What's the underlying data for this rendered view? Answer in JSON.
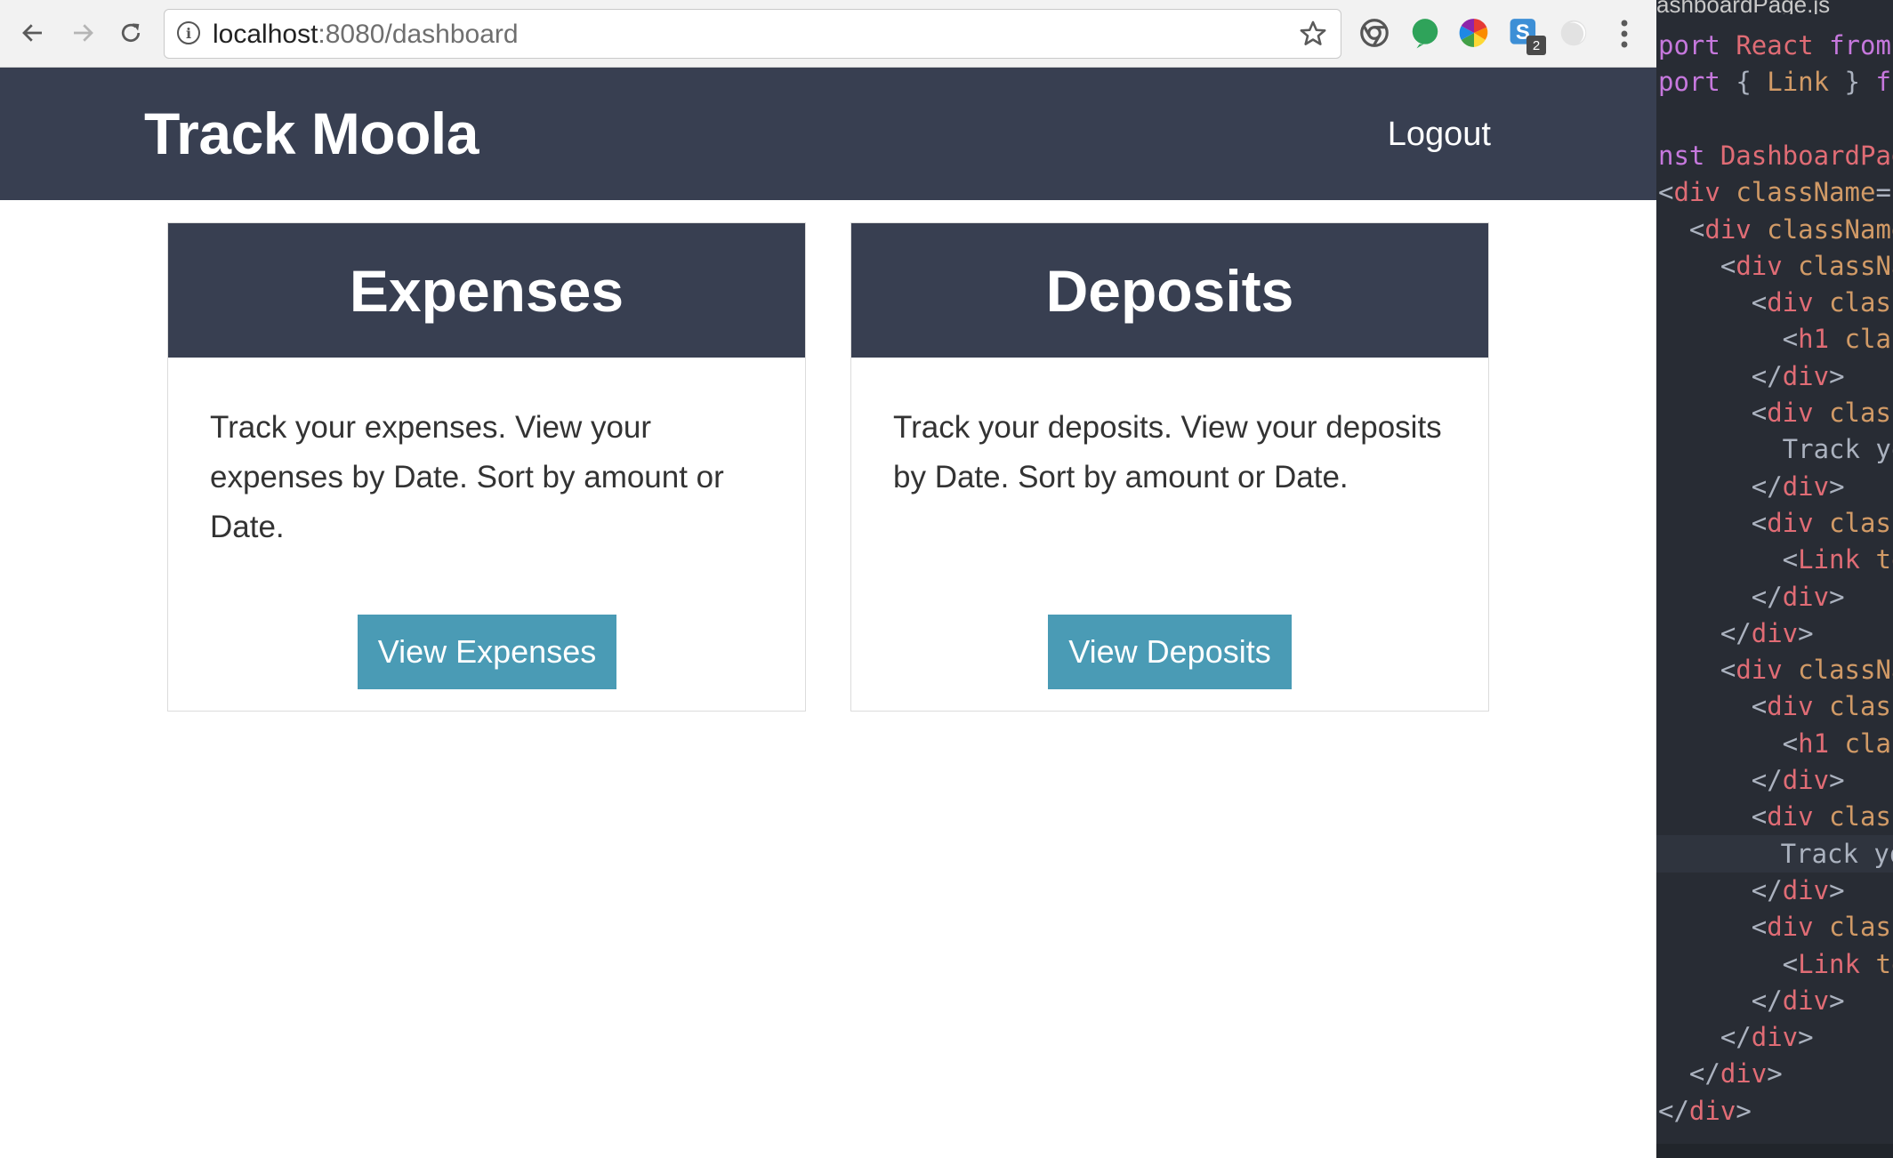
{
  "browser": {
    "url_host": "localhost",
    "url_rest": ":8080/dashboard",
    "extensions": [
      {
        "icon": "chrome-circle-icon"
      },
      {
        "icon": "green-leaf-icon"
      },
      {
        "icon": "color-wheel-icon"
      },
      {
        "icon": "s-extension-icon",
        "badge": "2"
      },
      {
        "icon": "faded-extension-icon"
      }
    ]
  },
  "app": {
    "brand": "Track Moola",
    "logout_label": "Logout",
    "header_color": "#383f51",
    "button_color": "#4a9bb5"
  },
  "cards": [
    {
      "title": "Expenses",
      "description": "Track your expenses. View your expenses by Date. Sort by amount or Date.",
      "button_label": "View Expenses"
    },
    {
      "title": "Deposits",
      "description": "Track your deposits. View your deposits by Date. Sort by amount or Date.",
      "button_label": "View Deposits"
    }
  ],
  "editor": {
    "tab_title": "ashboardPage.js",
    "lines": [
      {
        "tokens": [
          {
            "t": "port ",
            "c": "kw"
          },
          {
            "t": "React ",
            "c": "tag"
          },
          {
            "t": "from",
            "c": "kw"
          }
        ]
      },
      {
        "tokens": [
          {
            "t": "port ",
            "c": "kw"
          },
          {
            "t": "{ ",
            "c": "plain"
          },
          {
            "t": "Link",
            "c": "attr"
          },
          {
            "t": " } ",
            "c": "plain"
          },
          {
            "t": "fr",
            "c": "kw"
          }
        ]
      },
      {
        "tokens": []
      },
      {
        "tokens": [
          {
            "t": "nst ",
            "c": "kw"
          },
          {
            "t": "DashboardPag",
            "c": "tag"
          }
        ]
      },
      {
        "tokens": [
          {
            "t": "<",
            "c": "plain"
          },
          {
            "t": "div ",
            "c": "tag"
          },
          {
            "t": "className",
            "c": "attr"
          },
          {
            "t": "=\"",
            "c": "plain"
          }
        ]
      },
      {
        "tokens": [
          {
            "t": "  <",
            "c": "plain"
          },
          {
            "t": "div ",
            "c": "tag"
          },
          {
            "t": "className",
            "c": "attr"
          }
        ]
      },
      {
        "tokens": [
          {
            "t": "    <",
            "c": "plain"
          },
          {
            "t": "div ",
            "c": "tag"
          },
          {
            "t": "classNa",
            "c": "attr"
          }
        ]
      },
      {
        "tokens": [
          {
            "t": "      <",
            "c": "plain"
          },
          {
            "t": "div ",
            "c": "tag"
          },
          {
            "t": "class",
            "c": "attr"
          }
        ]
      },
      {
        "tokens": [
          {
            "t": "        <",
            "c": "plain"
          },
          {
            "t": "h1 ",
            "c": "tag"
          },
          {
            "t": "clas",
            "c": "attr"
          }
        ]
      },
      {
        "tokens": [
          {
            "t": "      </",
            "c": "plain"
          },
          {
            "t": "div",
            "c": "tag"
          },
          {
            "t": ">",
            "c": "plain"
          }
        ]
      },
      {
        "tokens": [
          {
            "t": "      <",
            "c": "plain"
          },
          {
            "t": "div ",
            "c": "tag"
          },
          {
            "t": "class",
            "c": "attr"
          }
        ]
      },
      {
        "tokens": [
          {
            "t": "        Track yo",
            "c": "plain"
          }
        ]
      },
      {
        "tokens": [
          {
            "t": "      </",
            "c": "plain"
          },
          {
            "t": "div",
            "c": "tag"
          },
          {
            "t": ">",
            "c": "plain"
          }
        ]
      },
      {
        "tokens": [
          {
            "t": "      <",
            "c": "plain"
          },
          {
            "t": "div ",
            "c": "tag"
          },
          {
            "t": "class",
            "c": "attr"
          }
        ]
      },
      {
        "tokens": [
          {
            "t": "        <",
            "c": "plain"
          },
          {
            "t": "Link ",
            "c": "tag"
          },
          {
            "t": "to",
            "c": "attr"
          }
        ]
      },
      {
        "tokens": [
          {
            "t": "      </",
            "c": "plain"
          },
          {
            "t": "div",
            "c": "tag"
          },
          {
            "t": ">",
            "c": "plain"
          }
        ]
      },
      {
        "tokens": [
          {
            "t": "    </",
            "c": "plain"
          },
          {
            "t": "div",
            "c": "tag"
          },
          {
            "t": ">",
            "c": "plain"
          }
        ]
      },
      {
        "tokens": [
          {
            "t": "    <",
            "c": "plain"
          },
          {
            "t": "div ",
            "c": "tag"
          },
          {
            "t": "classNa",
            "c": "attr"
          }
        ]
      },
      {
        "tokens": [
          {
            "t": "      <",
            "c": "plain"
          },
          {
            "t": "div ",
            "c": "tag"
          },
          {
            "t": "class",
            "c": "attr"
          }
        ]
      },
      {
        "tokens": [
          {
            "t": "        <",
            "c": "plain"
          },
          {
            "t": "h1 ",
            "c": "tag"
          },
          {
            "t": "clas",
            "c": "attr"
          }
        ]
      },
      {
        "tokens": [
          {
            "t": "      </",
            "c": "plain"
          },
          {
            "t": "div",
            "c": "tag"
          },
          {
            "t": ">",
            "c": "plain"
          }
        ]
      },
      {
        "tokens": [
          {
            "t": "      <",
            "c": "plain"
          },
          {
            "t": "div ",
            "c": "tag"
          },
          {
            "t": "class",
            "c": "attr"
          }
        ]
      },
      {
        "highlight": true,
        "tokens": [
          {
            "t": "        Track yo",
            "c": "plain"
          }
        ]
      },
      {
        "tokens": [
          {
            "t": "      </",
            "c": "plain"
          },
          {
            "t": "div",
            "c": "tag"
          },
          {
            "t": ">",
            "c": "plain"
          }
        ]
      },
      {
        "tokens": [
          {
            "t": "      <",
            "c": "plain"
          },
          {
            "t": "div ",
            "c": "tag"
          },
          {
            "t": "class",
            "c": "attr"
          }
        ]
      },
      {
        "tokens": [
          {
            "t": "        <",
            "c": "plain"
          },
          {
            "t": "Link ",
            "c": "tag"
          },
          {
            "t": "to",
            "c": "attr"
          }
        ]
      },
      {
        "tokens": [
          {
            "t": "      </",
            "c": "plain"
          },
          {
            "t": "div",
            "c": "tag"
          },
          {
            "t": ">",
            "c": "plain"
          }
        ]
      },
      {
        "tokens": [
          {
            "t": "    </",
            "c": "plain"
          },
          {
            "t": "div",
            "c": "tag"
          },
          {
            "t": ">",
            "c": "plain"
          }
        ]
      },
      {
        "tokens": [
          {
            "t": "  </",
            "c": "plain"
          },
          {
            "t": "div",
            "c": "tag"
          },
          {
            "t": ">",
            "c": "plain"
          }
        ]
      },
      {
        "tokens": [
          {
            "t": "</",
            "c": "plain"
          },
          {
            "t": "div",
            "c": "tag"
          },
          {
            "t": ">",
            "c": "plain"
          }
        ]
      }
    ]
  }
}
